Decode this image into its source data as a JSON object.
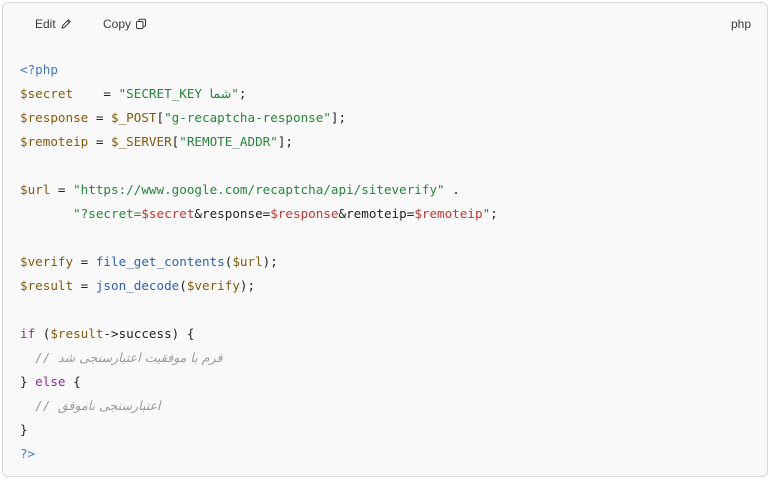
{
  "toolbar": {
    "edit_label": "Edit",
    "copy_label": "Copy",
    "language": "php",
    "edit_icon": "pencil-icon",
    "copy_icon": "copy-icon"
  },
  "code": {
    "language": "php",
    "lines": [
      "<?php",
      "$secret    = \"SECRET_KEY شما\";",
      "$response = $_POST[\"g-recaptcha-response\"];",
      "$remoteip = $_SERVER[\"REMOTE_ADDR\"];",
      "",
      "$url = \"https://www.google.com/recaptcha/api/siteverify\" .",
      "       \"?secret=$secret&response=$response&remoteip=$remoteip\";",
      "",
      "$verify = file_get_contents($url);",
      "$result = json_decode($verify);",
      "",
      "if ($result->success) {",
      "  // فرم با موفقیت اعتبارسنجی شد",
      "} else {",
      "  // اعتبارسنجی ناموفق",
      "}",
      "?>"
    ],
    "tokens": {
      "open_tag": "<?php",
      "close_tag": "?>",
      "kw_if": "if",
      "kw_else": "else",
      "v_secret": "$secret",
      "v_response": "$response",
      "v_remoteip": "$remoteip",
      "v_url": "$url",
      "v_verify": "$verify",
      "v_result": "$result",
      "v_post": "$_POST",
      "v_server": "$_SERVER",
      "s_secret_key": "\"SECRET_KEY شما\"",
      "s_secret_key_a": "\"SECRET_KEY ",
      "s_secret_key_b": "شما",
      "s_secret_key_c": "\"",
      "s_recaptcha": "\"g-recaptcha-response\"",
      "s_remote_addr": "\"REMOTE_ADDR\"",
      "s_url": "\"https://www.google.com/recaptcha/api/siteverify\"",
      "s_q_open": "\"?secret=",
      "s_amp_response": "&response=",
      "s_amp_remoteip": "&remoteip=",
      "s_q_close": "\"",
      "fn_fgc": "file_get_contents",
      "fn_jd": "json_decode",
      "prop_success": "success",
      "comment_slashes": "// ",
      "comment_success": "فرم با موفقیت اعتبارسنجی شد",
      "comment_fail": "اعتبارسنجی ناموفق"
    }
  }
}
